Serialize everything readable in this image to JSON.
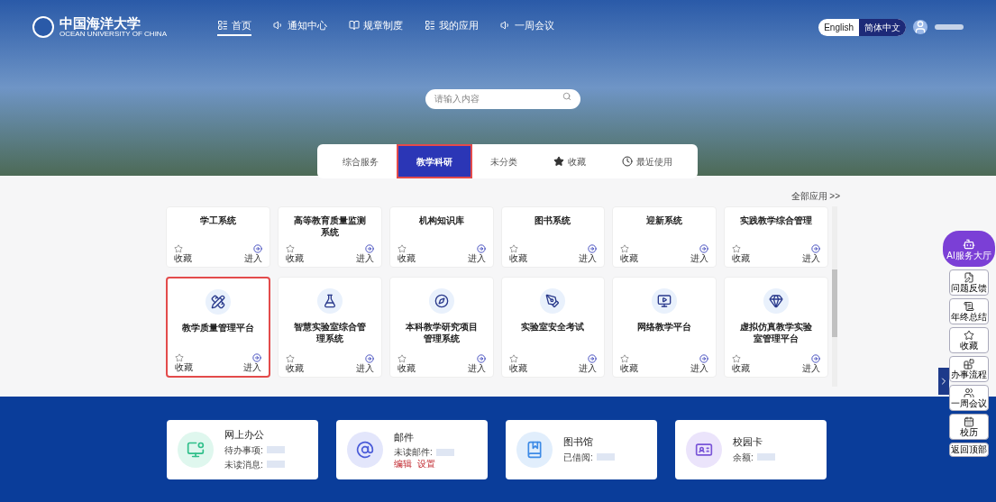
{
  "header": {
    "logo": {
      "name": "中国海洋大学",
      "sub": "OCEAN UNIVERSITY OF CHINA"
    },
    "nav": [
      {
        "label": "首页",
        "selected": true
      },
      {
        "label": "通知中心",
        "selected": false
      },
      {
        "label": "规章制度",
        "selected": false
      },
      {
        "label": "我的应用",
        "selected": false
      },
      {
        "label": "一周会议",
        "selected": false
      }
    ],
    "languages": [
      {
        "label": "English",
        "selected": false
      },
      {
        "label": "简体中文",
        "selected": true
      }
    ]
  },
  "search": {
    "placeholder": "请输入内容"
  },
  "tabs": [
    {
      "label": "综合服务",
      "selected": false,
      "kind": "plain"
    },
    {
      "label": "教学科研",
      "selected": true,
      "kind": "plain"
    },
    {
      "label": "未分类",
      "selected": false,
      "kind": "plain"
    },
    {
      "label": "收藏",
      "selected": false,
      "kind": "star"
    },
    {
      "label": "最近使用",
      "selected": false,
      "kind": "recent"
    }
  ],
  "all_apps": "全部应用 >>",
  "apps": [
    {
      "name": "学工系统",
      "kind": "partial",
      "highlighted": false,
      "favorite": "收藏",
      "enter": "进入"
    },
    {
      "name": "高等教育质量监测系统",
      "kind": "partial",
      "highlighted": false,
      "favorite": "收藏",
      "enter": "进入"
    },
    {
      "name": "机构知识库",
      "kind": "partial",
      "highlighted": false,
      "favorite": "收藏",
      "enter": "进入"
    },
    {
      "name": "图书系统",
      "kind": "partial",
      "highlighted": false,
      "favorite": "收藏",
      "enter": "进入"
    },
    {
      "name": "迎新系统",
      "kind": "partial",
      "highlighted": false,
      "favorite": "收藏",
      "enter": "进入"
    },
    {
      "name": "实践教学综合管理",
      "kind": "partial",
      "highlighted": false,
      "favorite": "收藏",
      "enter": "进入"
    },
    {
      "name": "教学质量管理平台",
      "kind": "full",
      "highlighted": true,
      "favorite": "收藏",
      "enter": "进入"
    },
    {
      "name": "智慧实验室综合管理系统",
      "kind": "full",
      "highlighted": false,
      "favorite": "收藏",
      "enter": "进入"
    },
    {
      "name": "本科教学研究项目管理系统",
      "kind": "full",
      "highlighted": false,
      "favorite": "收藏",
      "enter": "进入"
    },
    {
      "name": "实验室安全考试",
      "kind": "full",
      "highlighted": false,
      "favorite": "收藏",
      "enter": "进入"
    },
    {
      "name": "网络教学平台",
      "kind": "full",
      "highlighted": false,
      "favorite": "收藏",
      "enter": "进入"
    },
    {
      "name": "虚拟仿真教学实验室管理平台",
      "kind": "full",
      "highlighted": false,
      "favorite": "收藏",
      "enter": "进入"
    }
  ],
  "quick_cards": [
    {
      "title": "网上办公",
      "lines": [
        "待办事项:",
        "未读消息:"
      ]
    },
    {
      "title": "邮件",
      "lines": [
        "未读邮件:"
      ],
      "actions": [
        "编辑",
        "设置"
      ]
    },
    {
      "title": "图书馆",
      "lines": [
        "已借阅:"
      ]
    },
    {
      "title": "校园卡",
      "lines": [
        "余额:"
      ]
    }
  ],
  "side": {
    "ai": "AI服务大厅",
    "items": [
      "问题反馈",
      "年终总结",
      "收藏",
      "办事流程",
      "一周会议",
      "校历"
    ],
    "top": "返回顶部"
  }
}
